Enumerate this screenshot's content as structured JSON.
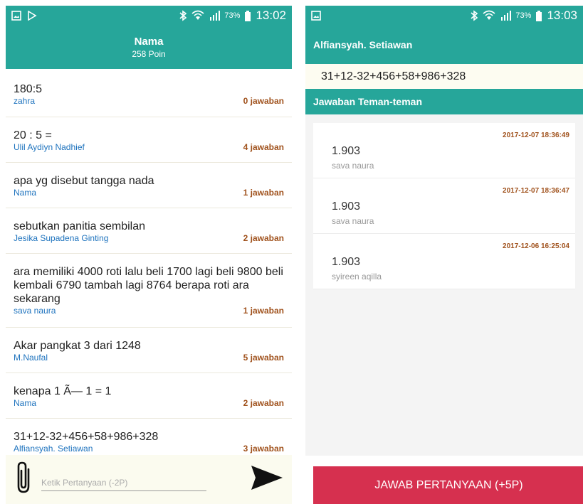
{
  "left": {
    "status": {
      "battery": "73%",
      "time": "13:02"
    },
    "header": {
      "title": "Nama",
      "points": "258 Poin"
    },
    "questions": [
      {
        "text": "180:5",
        "author": "zahra",
        "answers": "0 jawaban"
      },
      {
        "text": "20 : 5 =",
        "author": "Ulil Aydiyn Nadhief",
        "answers": "4 jawaban"
      },
      {
        "text": "apa yg disebut tangga nada",
        "author": "Nama",
        "answers": "1 jawaban"
      },
      {
        "text": "sebutkan panitia sembilan",
        "author": "Jesika Supadena Ginting",
        "answers": "2 jawaban"
      },
      {
        "text": "ara memiliki 4000 roti lalu beli 1700 lagi beli 9800 beli kembali 6790 tambah lagi 8764 berapa roti ara sekarang",
        "author": "sava naura",
        "answers": "1 jawaban"
      },
      {
        "text": "Akar pangkat 3 dari 1248",
        "author": "M.Naufal",
        "answers": "5 jawaban"
      },
      {
        "text": "kenapa 1 Ã— 1 = 1",
        "author": "Nama",
        "answers": "2 jawaban"
      },
      {
        "text": "31+12-32+456+58+986+328",
        "author": "Alfiansyah. Setiawan",
        "answers": "3 jawaban"
      }
    ],
    "composer": {
      "placeholder": "Ketik Pertanyaan (-2P)"
    },
    "icons": {
      "attach": "paperclip-icon",
      "send": "send-icon"
    }
  },
  "right": {
    "status": {
      "battery": "73%",
      "time": "13:03"
    },
    "author": "Alfiansyah. Setiawan",
    "question": "31+12-32+456+58+986+328",
    "section_title": "Jawaban Teman-teman",
    "answers": [
      {
        "date": "2017-12-07 18:36:49",
        "value": "1.903",
        "name": "sava naura"
      },
      {
        "date": "2017-12-07 18:36:47",
        "value": "1.903",
        "name": "sava naura"
      },
      {
        "date": "2017-12-06 16:25:04",
        "value": "1.903",
        "name": "syireen aqilla"
      }
    ],
    "answer_button": "JAWAB PERTANYAAN (+5P)"
  },
  "colors": {
    "primary": "#26a69a",
    "accent": "#d6304f",
    "answer_count": "#a0521d",
    "author": "#1e73be"
  }
}
